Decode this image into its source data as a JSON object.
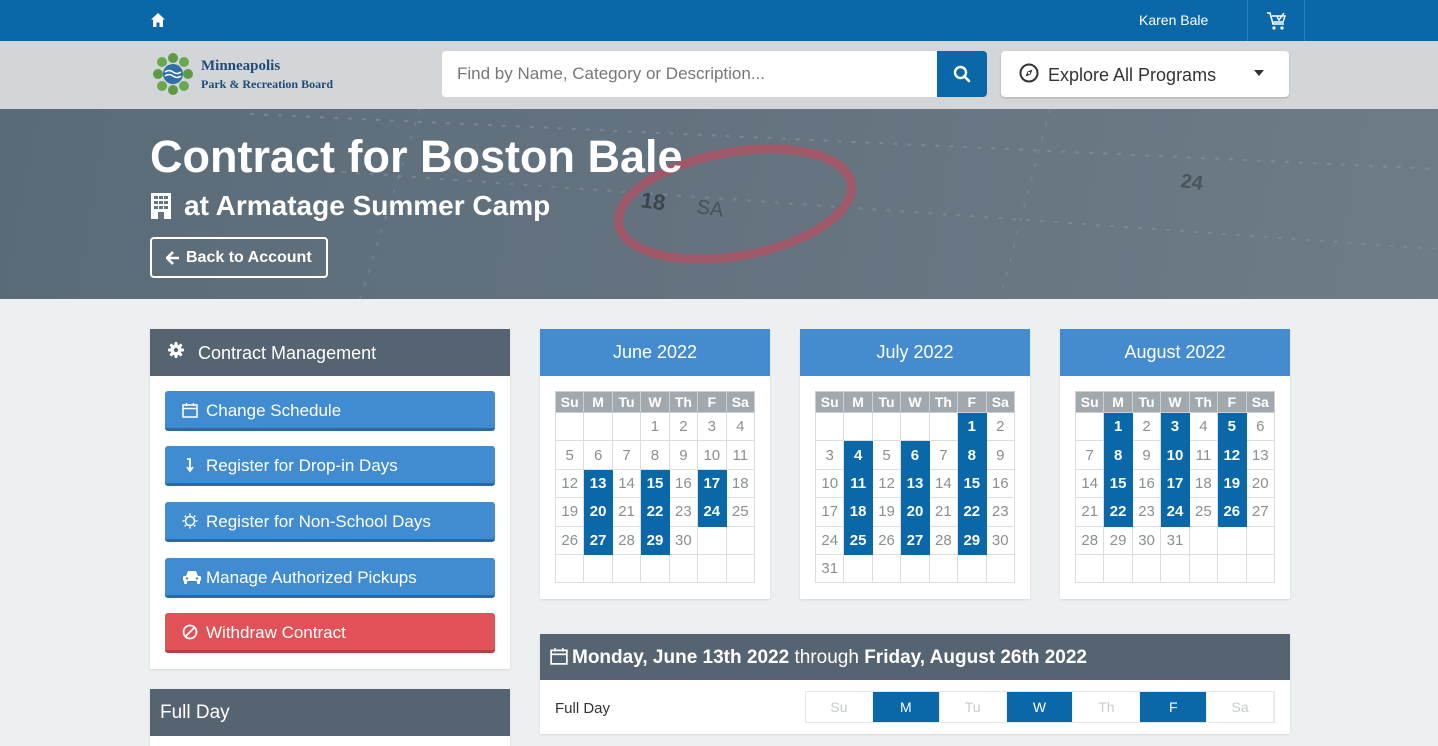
{
  "topbar": {
    "user_name": "Karen Bale"
  },
  "header": {
    "logo_line1": "Minneapolis",
    "logo_line2": "Park & Recreation Board",
    "search_placeholder": "Find by Name, Category or Description...",
    "explore_label": "Explore All Programs"
  },
  "hero": {
    "title": "Contract for Boston Bale",
    "subtitle": "at Armatage Summer Camp",
    "back_label": "Back to Account"
  },
  "contract_management": {
    "title": "Contract Management",
    "actions": [
      {
        "label": "Change Schedule",
        "icon": "calendar-icon"
      },
      {
        "label": "Register for Drop-in Days",
        "icon": "arrow-down-icon"
      },
      {
        "label": "Register for Non-School Days",
        "icon": "sun-icon"
      },
      {
        "label": "Manage Authorized Pickups",
        "icon": "car-icon"
      },
      {
        "label": "Withdraw Contract",
        "icon": "ban-icon"
      }
    ]
  },
  "full_day_panel": {
    "title": "Full Day"
  },
  "calendar": {
    "weekdays": [
      "Su",
      "M",
      "Tu",
      "W",
      "Th",
      "F",
      "Sa"
    ],
    "months": [
      {
        "title": "June 2022",
        "weeks": [
          [
            "",
            "",
            "",
            "1",
            "2",
            "3",
            "4"
          ],
          [
            "5",
            "6",
            "7",
            "8",
            "9",
            "10",
            "11"
          ],
          [
            "12",
            "13",
            "14",
            "15",
            "16",
            "17",
            "18"
          ],
          [
            "19",
            "20",
            "21",
            "22",
            "23",
            "24",
            "25"
          ],
          [
            "26",
            "27",
            "28",
            "29",
            "30",
            "",
            ""
          ],
          [
            "",
            "",
            "",
            "",
            "",
            "",
            ""
          ]
        ],
        "selected": [
          "13",
          "15",
          "17",
          "20",
          "22",
          "24",
          "27",
          "29"
        ]
      },
      {
        "title": "July 2022",
        "weeks": [
          [
            "",
            "",
            "",
            "",
            "",
            "1",
            "2"
          ],
          [
            "3",
            "4",
            "5",
            "6",
            "7",
            "8",
            "9"
          ],
          [
            "10",
            "11",
            "12",
            "13",
            "14",
            "15",
            "16"
          ],
          [
            "17",
            "18",
            "19",
            "20",
            "21",
            "22",
            "23"
          ],
          [
            "24",
            "25",
            "26",
            "27",
            "28",
            "29",
            "30"
          ],
          [
            "31",
            "",
            "",
            "",
            "",
            "",
            ""
          ]
        ],
        "selected": [
          "1",
          "4",
          "6",
          "8",
          "11",
          "13",
          "15",
          "18",
          "20",
          "22",
          "25",
          "27",
          "29"
        ]
      },
      {
        "title": "August 2022",
        "weeks": [
          [
            "",
            "1",
            "2",
            "3",
            "4",
            "5",
            "6"
          ],
          [
            "7",
            "8",
            "9",
            "10",
            "11",
            "12",
            "13"
          ],
          [
            "14",
            "15",
            "16",
            "17",
            "18",
            "19",
            "20"
          ],
          [
            "21",
            "22",
            "23",
            "24",
            "25",
            "26",
            "27"
          ],
          [
            "28",
            "29",
            "30",
            "31",
            "",
            "",
            ""
          ],
          [
            "",
            "",
            "",
            "",
            "",
            "",
            ""
          ]
        ],
        "selected": [
          "1",
          "3",
          "5",
          "8",
          "10",
          "12",
          "15",
          "17",
          "19",
          "22",
          "24",
          "26"
        ]
      }
    ]
  },
  "schedule": {
    "start": "Monday, June 13th 2022",
    "through": "through",
    "end": "Friday, August 26th 2022",
    "row_label": "Full Day",
    "days": [
      {
        "label": "Su",
        "selected": false
      },
      {
        "label": "M",
        "selected": true
      },
      {
        "label": "Tu",
        "selected": false
      },
      {
        "label": "W",
        "selected": true
      },
      {
        "label": "Th",
        "selected": false
      },
      {
        "label": "F",
        "selected": true
      },
      {
        "label": "Sa",
        "selected": false
      }
    ]
  },
  "colors": {
    "primary": "#0a67a8",
    "button_blue": "#418bd0",
    "danger": "#e05257",
    "panel_header": "#566370",
    "month_header": "#448bcf"
  }
}
